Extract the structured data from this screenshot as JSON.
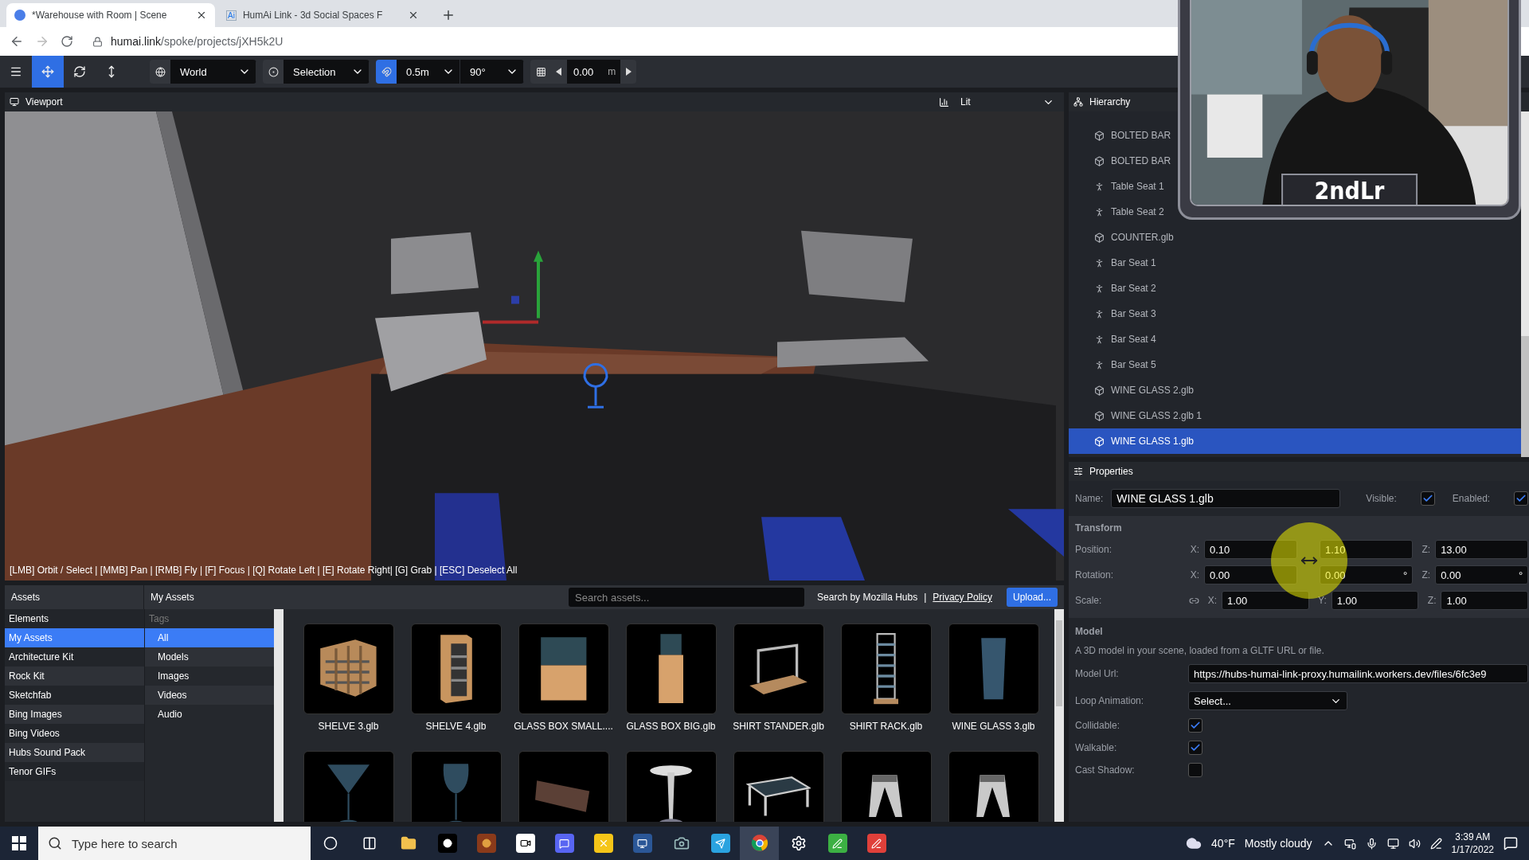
{
  "browser": {
    "tabs": [
      {
        "title": "*Warehouse with Room | Scene",
        "selected": true
      },
      {
        "title": "HumAi Link - 3d Social Spaces F",
        "icon_text": "Ai",
        "selected": false
      }
    ],
    "address": {
      "host": "humai.link",
      "path": "/spoke/projects/jXH5k2U"
    }
  },
  "toolbar": {
    "tools": [
      {
        "kind": "menu",
        "selected": false
      },
      {
        "kind": "move",
        "selected": true
      },
      {
        "kind": "rotate",
        "selected": false
      },
      {
        "kind": "scale",
        "selected": false
      }
    ],
    "space": "World",
    "pivot": "Selection",
    "snap": {
      "on": true,
      "translate": "0.5m",
      "rotate": "90°"
    },
    "grid": {
      "value": "0.00",
      "unit": "m"
    }
  },
  "viewport": {
    "title": "Viewport",
    "shading": "Lit",
    "hint": "[LMB] Orbit / Select | [MMB] Pan | [RMB] Fly | [F] Focus | [Q] Rotate Left | [E] Rotate Right| [G] Grab | [ESC] Deselect All"
  },
  "hierarchy": {
    "title": "Hierarchy",
    "items": [
      {
        "label": "BOLTED BAR",
        "kind": "model",
        "selected": false
      },
      {
        "label": "BOLTED BAR",
        "kind": "model",
        "selected": false
      },
      {
        "label": "Table Seat 1",
        "kind": "spawn",
        "selected": false
      },
      {
        "label": "Table Seat 2",
        "kind": "spawn",
        "selected": false
      },
      {
        "label": "COUNTER.glb",
        "kind": "model",
        "selected": false
      },
      {
        "label": "Bar Seat 1",
        "kind": "spawn",
        "selected": false
      },
      {
        "label": "Bar Seat 2",
        "kind": "spawn",
        "selected": false
      },
      {
        "label": "Bar Seat 3",
        "kind": "spawn",
        "selected": false
      },
      {
        "label": "Bar Seat 4",
        "kind": "spawn",
        "selected": false
      },
      {
        "label": "Bar Seat 5",
        "kind": "spawn",
        "selected": false
      },
      {
        "label": "WINE GLASS 2.glb",
        "kind": "model",
        "selected": false
      },
      {
        "label": "WINE GLASS 2.glb 1",
        "kind": "model",
        "selected": false
      },
      {
        "label": "WINE GLASS 1.glb",
        "kind": "model",
        "selected": true
      }
    ]
  },
  "properties": {
    "title": "Properties",
    "name_label": "Name:",
    "name": "WINE GLASS 1.glb",
    "toggles": [
      {
        "label": "Visible:",
        "checked": true
      },
      {
        "label": "Enabled:",
        "checked": true
      }
    ],
    "transform": {
      "title": "Transform",
      "rows": [
        {
          "label": "Position:",
          "linked": false,
          "fields": [
            {
              "axis": "X:",
              "value": "0.10"
            },
            {
              "value": "1.10"
            },
            {
              "axis": "Z:",
              "value": "13.00"
            }
          ]
        },
        {
          "label": "Rotation:",
          "linked": false,
          "fields": [
            {
              "axis": "X:",
              "value": "0.00"
            },
            {
              "value": "0.00",
              "unit": "°"
            },
            {
              "axis": "Z:",
              "value": "0.00",
              "unit": "°"
            }
          ]
        },
        {
          "label": "Scale:",
          "linked": true,
          "fields": [
            {
              "axis": "X:",
              "value": "1.00"
            },
            {
              "axis": "Y:",
              "value": "1.00"
            },
            {
              "axis": "Z:",
              "value": "1.00"
            }
          ]
        }
      ]
    },
    "model": {
      "title": "Model",
      "description": "A 3D model in your scene, loaded from a GLTF URL or file.",
      "url_label": "Model Url:",
      "url": "https://hubs-humai-link-proxy.humailink.workers.dev/files/6fc3e9",
      "loop_label": "Loop Animation:",
      "loop": "Select...",
      "flags": [
        {
          "label": "Collidable:",
          "checked": true
        },
        {
          "label": "Walkable:",
          "checked": true
        },
        {
          "label": "Cast Shadow:",
          "checked": false
        }
      ]
    }
  },
  "assets": {
    "title": "Assets",
    "section": "My Assets",
    "search_placeholder": "Search assets...",
    "search_by": "Search by Mozilla Hubs",
    "separator": "|",
    "privacy": "Privacy Policy",
    "upload": "Upload...",
    "sources": [
      {
        "label": "Elements",
        "selected": false
      },
      {
        "label": "My Assets",
        "selected": true
      },
      {
        "label": "Architecture Kit",
        "selected": false
      },
      {
        "label": "Rock Kit",
        "selected": false
      },
      {
        "label": "Sketchfab",
        "selected": false
      },
      {
        "label": "Bing Images",
        "selected": false
      },
      {
        "label": "Bing Videos",
        "selected": false
      },
      {
        "label": "Hubs Sound Pack",
        "selected": false
      },
      {
        "label": "Tenor GIFs",
        "selected": false
      }
    ],
    "tags_title": "Tags",
    "tags": [
      {
        "label": "All",
        "selected": true
      },
      {
        "label": "Models",
        "selected": false
      },
      {
        "label": "Images",
        "selected": false
      },
      {
        "label": "Videos",
        "selected": false
      },
      {
        "label": "Audio",
        "selected": false
      }
    ],
    "items": [
      {
        "label": "SHELVE 3.glb",
        "kind": "shelf"
      },
      {
        "label": "SHELVE 4.glb",
        "kind": "cabinet"
      },
      {
        "label": "GLASS BOX SMALL....",
        "kind": "case"
      },
      {
        "label": "GLASS BOX BIG.glb",
        "kind": "tallcase"
      },
      {
        "label": "SHIRT STANDER.glb",
        "kind": "stander"
      },
      {
        "label": "SHIRT RACK.glb",
        "kind": "rack"
      },
      {
        "label": "WINE GLASS 3.glb",
        "kind": "glass"
      },
      {
        "kind": "cocktail"
      },
      {
        "kind": "wineglass"
      },
      {
        "kind": "plank"
      },
      {
        "kind": "stool"
      },
      {
        "kind": "table"
      },
      {
        "kind": "legs"
      },
      {
        "kind": "legs"
      }
    ]
  },
  "taskbar": {
    "search_placeholder": "Type here to search",
    "temperature": "40°F",
    "weather": "Mostly cloudy",
    "time": "3:39 AM",
    "date": "1/17/2022"
  },
  "webcam": {
    "caption": "2ndLr"
  }
}
